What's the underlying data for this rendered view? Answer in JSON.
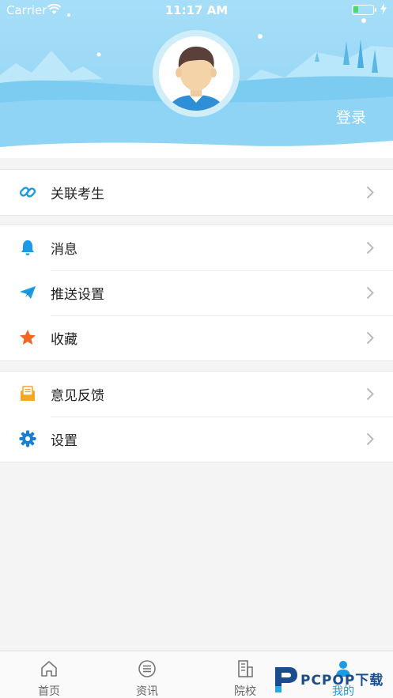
{
  "status_bar": {
    "carrier": "Carrier",
    "time": "11:17 AM"
  },
  "header": {
    "login_label": "登录"
  },
  "menu_groups": [
    {
      "items": [
        {
          "label": "关联考生",
          "icon": "link-icon"
        }
      ]
    },
    {
      "items": [
        {
          "label": "消息",
          "icon": "bell-icon"
        },
        {
          "label": "推送设置",
          "icon": "paper-plane-icon"
        },
        {
          "label": "收藏",
          "icon": "star-icon"
        }
      ]
    },
    {
      "items": [
        {
          "label": "意见反馈",
          "icon": "feedback-envelope-icon"
        },
        {
          "label": "设置",
          "icon": "gear-icon"
        }
      ]
    }
  ],
  "tabbar": {
    "tabs": [
      {
        "label": "首页",
        "icon": "home-icon"
      },
      {
        "label": "资讯",
        "icon": "news-list-icon"
      },
      {
        "label": "院校",
        "icon": "building-icon"
      },
      {
        "label": "我的",
        "icon": "person-icon",
        "active": true
      }
    ]
  },
  "watermark": {
    "text": "PCPOP下载"
  },
  "colors": {
    "accent": "#1a9be6",
    "header_bg": "#a8dff7",
    "star": "#f26522",
    "mail": "#f5a623"
  }
}
